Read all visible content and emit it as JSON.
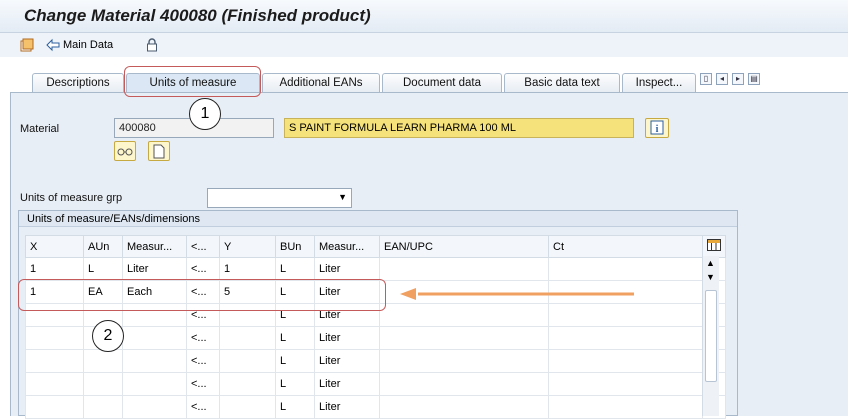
{
  "window": {
    "title": "Change Material 400080 (Finished product)"
  },
  "toolbar": {
    "main_data_label": "Main Data"
  },
  "tabs": [
    {
      "label": "Descriptions"
    },
    {
      "label": "Units of measure"
    },
    {
      "label": "Additional EANs"
    },
    {
      "label": "Document data"
    },
    {
      "label": "Basic data text"
    },
    {
      "label": "Inspect..."
    }
  ],
  "header": {
    "material_label": "Material",
    "material_value": "400080",
    "description_value": "S PAINT FORMULA LEARN PHARMA 100 ML",
    "uom_grp_label": "Units of measure grp",
    "uom_grp_value": ""
  },
  "grid": {
    "title": "Units of measure/EANs/dimensions",
    "columns": [
      "X",
      "AUn",
      "Measur...",
      "<...",
      "Y",
      "BUn",
      "Measur...",
      "EAN/UPC",
      "Ct"
    ],
    "rows": [
      [
        "1",
        "L",
        "Liter",
        "<...",
        "1",
        "L",
        "Liter",
        "",
        ""
      ],
      [
        "1",
        "EA",
        "Each",
        "<...",
        "5",
        "L",
        "Liter",
        "",
        ""
      ],
      [
        "",
        "",
        "",
        "<...",
        "",
        "L",
        "Liter",
        "",
        ""
      ],
      [
        "",
        "",
        "",
        "<...",
        "",
        "L",
        "Liter",
        "",
        ""
      ],
      [
        "",
        "",
        "",
        "<...",
        "",
        "L",
        "Liter",
        "",
        ""
      ],
      [
        "",
        "",
        "",
        "<...",
        "",
        "L",
        "Liter",
        "",
        ""
      ],
      [
        "",
        "",
        "",
        "<...",
        "",
        "L",
        "Liter",
        "",
        ""
      ]
    ]
  },
  "annotations": {
    "circle1": "1",
    "circle2": "2"
  },
  "colors": {
    "accent_arrow": "#f0a060",
    "highlight_box": "#c55a5a",
    "field_yellow": "#f5e27a"
  },
  "icons": [
    "other-material-icon",
    "back-arrow-icon",
    "lock-icon",
    "info-icon",
    "glasses-icon",
    "new-doc-icon"
  ]
}
